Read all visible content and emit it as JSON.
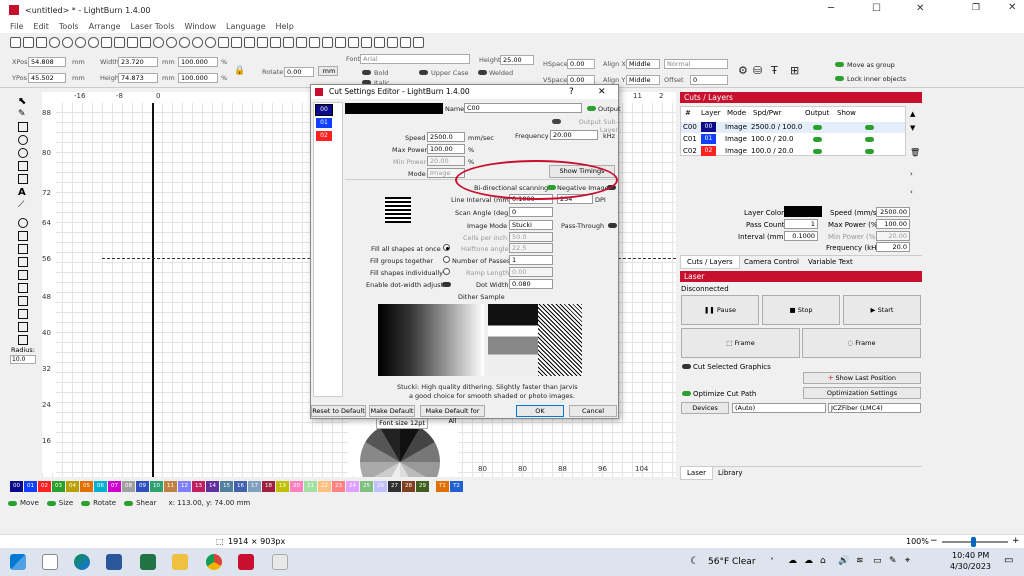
{
  "app": {
    "title": "<untitled> * - LightBurn 1.4.00"
  },
  "menu": [
    "File",
    "Edit",
    "Tools",
    "Arrange",
    "Laser Tools",
    "Window",
    "Language",
    "Help"
  ],
  "props": {
    "xpos_label": "XPos",
    "xpos": "54.808",
    "ypos_label": "YPos",
    "ypos": "45.502",
    "unit": "mm",
    "width_label": "Width",
    "width": "23.720",
    "height_label": "Height",
    "height": "74.873",
    "w_pct": "100.000",
    "h_pct": "100.000",
    "pct": "%",
    "rotate_label": "Rotate",
    "rotate": "0.00",
    "mm_btn": "mm",
    "font_label": "Font",
    "font": "Arial",
    "bold": "Bold",
    "italic": "Italic",
    "upper_case": "Upper Case",
    "welded": "Welded",
    "fheight_label": "Height",
    "fheight": "25.00",
    "hspace_label": "HSpace",
    "hspace": "0.00",
    "vspace_label": "VSpace",
    "vspace": "0.00",
    "alignx_label": "Align X",
    "alignx": "Middle",
    "aligny_label": "Align Y",
    "aligny": "Middle",
    "normal": "Normal",
    "offset_label": "Offset",
    "offset": "0",
    "move_group": "Move as group",
    "lock_inner": "Lock inner objects"
  },
  "ruler": {
    "top": [
      "-16",
      "-8",
      "0"
    ],
    "top_right": [
      "80",
      "88",
      "96",
      "104",
      "11",
      "2"
    ],
    "left": [
      "88",
      "80",
      "72",
      "64",
      "56",
      "48",
      "40",
      "32",
      "24",
      "16"
    ]
  },
  "tools": {
    "radius_label": "Radius:",
    "radius": "10.0"
  },
  "dialog": {
    "title": "Cut Settings Editor - LightBurn 1.4.00",
    "help": "?",
    "close": "✕",
    "layers": [
      {
        "id": "00",
        "color": "#0a0a8a"
      },
      {
        "id": "01",
        "color": "#1040ff"
      },
      {
        "id": "02",
        "color": "#ff2020"
      }
    ],
    "name_label": "Name",
    "name": "C00",
    "output": "Output",
    "output_sublayer": "Output Sub-Layer",
    "speed_label": "Speed",
    "speed": "2500.0",
    "speed_unit": "mm/sec",
    "frequency_label": "Frequency",
    "frequency": "20.00",
    "freq_unit": "kHz",
    "maxpower_label": "Max Power",
    "maxpower": "100.00",
    "minpower_label": "Min Power",
    "minpower": "20.00",
    "pct": "%",
    "mode_label": "Mode",
    "mode": "Image",
    "show_timings": "Show Timings",
    "bidir": "Bi-directional scanning",
    "negative": "Negative Image",
    "line_interval_label": "Line Interval (mm)",
    "line_interval": "0.1000",
    "dpi_val": "254",
    "dpi": "DPI",
    "scan_angle_label": "Scan Angle (deg)",
    "scan_angle": "0",
    "image_mode_label": "Image Mode",
    "image_mode": "Stucki",
    "pass_through": "Pass-Through",
    "cells_label": "Cells per inch",
    "cells": "50.0",
    "halftone_label": "Halftone angle",
    "halftone": "22.5",
    "fill_all": "Fill all shapes at once",
    "fill_groups": "Fill groups together",
    "fill_indiv": "Fill shapes individually",
    "dot_width_adj": "Enable dot-width adjust",
    "passes_label": "Number of Passes",
    "passes": "1",
    "ramp_label": "Ramp Length",
    "ramp": "0.00",
    "dotwidth_label": "Dot Width",
    "dotwidth": "0.080",
    "dither_label": "Dither Sample",
    "desc1": "Stucki: High quality dithering. Slightly faster than Jarvis",
    "desc2": "a good choice for smooth shaded or photo images.",
    "reset": "Reset to Default",
    "make_default": "Make Default",
    "make_all": "Make Default for All",
    "ok": "OK",
    "cancel": "Cancel"
  },
  "canvas": {
    "font_size_label": "Font size 12pt"
  },
  "cuts": {
    "title": "Cuts / Layers",
    "headers": [
      "#",
      "Layer",
      "Mode",
      "Spd/Pwr",
      "Output",
      "Show"
    ],
    "rows": [
      {
        "id": "C00",
        "layer": "00",
        "color": "#0a0a8a",
        "mode": "Image",
        "sp": "2500.0 / 100.0"
      },
      {
        "id": "C01",
        "layer": "01",
        "color": "#1040ff",
        "mode": "Image",
        "sp": "100.0 / 20.0"
      },
      {
        "id": "C02",
        "layer": "02",
        "color": "#ff2020",
        "mode": "Image",
        "sp": "100.0 / 20.0"
      }
    ],
    "layer_color_label": "Layer Color",
    "speed_label": "Speed (mm/s)",
    "speed": "2500.00",
    "passcount_label": "Pass Count",
    "passcount": "1",
    "maxpower_label": "Max Power (%)",
    "maxpower": "100.00",
    "interval_label": "Interval (mm)",
    "interval": "0.1000",
    "minpower_label": "Min Power (%)",
    "minpower": "20.00",
    "frequency_label": "Frequency (kHz)",
    "frequency": "20.0",
    "tabs": [
      "Cuts / Layers",
      "Camera Control",
      "Variable Text"
    ]
  },
  "laser": {
    "title": "Laser",
    "status": "Disconnected",
    "pause": "Pause",
    "stop": "Stop",
    "start": "Start",
    "frame1": "Frame",
    "frame2": "Frame",
    "cut_selected": "Cut Selected Graphics",
    "show_last": "Show Last Position",
    "optimize": "Optimize Cut Path",
    "opt_settings": "Optimization Settings",
    "devices": "Devices",
    "auto": "(Auto)",
    "device": "JCZFiber (LMC4)",
    "tabs": [
      "Laser",
      "Library"
    ]
  },
  "palette": [
    {
      "l": "00",
      "c": "#0a0a8a"
    },
    {
      "l": "01",
      "c": "#1040ff"
    },
    {
      "l": "02",
      "c": "#ff2020"
    },
    {
      "l": "03",
      "c": "#2ca02c"
    },
    {
      "l": "04",
      "c": "#b8a000"
    },
    {
      "l": "05",
      "c": "#e07000"
    },
    {
      "l": "06",
      "c": "#00b0d0"
    },
    {
      "l": "07",
      "c": "#d000d0"
    },
    {
      "l": "08",
      "c": "#a0a0a0"
    },
    {
      "l": "09",
      "c": "#3050c0"
    },
    {
      "l": "10",
      "c": "#30a070"
    },
    {
      "l": "11",
      "c": "#c08040"
    },
    {
      "l": "12",
      "c": "#8080ff"
    },
    {
      "l": "13",
      "c": "#c02060"
    },
    {
      "l": "14",
      "c": "#6030a0"
    },
    {
      "l": "15",
      "c": "#5080a0"
    },
    {
      "l": "16",
      "c": "#4060b0"
    },
    {
      "l": "17",
      "c": "#80a0c0"
    },
    {
      "l": "18",
      "c": "#a02040"
    },
    {
      "l": "19",
      "c": "#c0c000"
    },
    {
      "l": "20",
      "c": "#ff80c0"
    },
    {
      "l": "21",
      "c": "#a0e0a0"
    },
    {
      "l": "22",
      "c": "#ffc080"
    },
    {
      "l": "23",
      "c": "#ff8080"
    },
    {
      "l": "24",
      "c": "#e0a0ff"
    },
    {
      "l": "25",
      "c": "#80c080"
    },
    {
      "l": "26",
      "c": "#c0c0ff"
    },
    {
      "l": "27",
      "c": "#303030"
    },
    {
      "l": "28",
      "c": "#804020"
    },
    {
      "l": "29",
      "c": "#406020"
    },
    {
      "l": "T1",
      "c": "#e07000"
    },
    {
      "l": "T2",
      "c": "#2060d0"
    }
  ],
  "status": {
    "move": "Move",
    "size": "Size",
    "rotate": "Rotate",
    "shear": "Shear",
    "coords": "x: 113.00, y: 74.00 mm"
  },
  "viewer": {
    "dims": "1914 × 903px",
    "zoom": "100%"
  },
  "taskbar": {
    "weather": "56°F  Clear",
    "time": "10:40 PM",
    "date": "4/30/2023"
  }
}
